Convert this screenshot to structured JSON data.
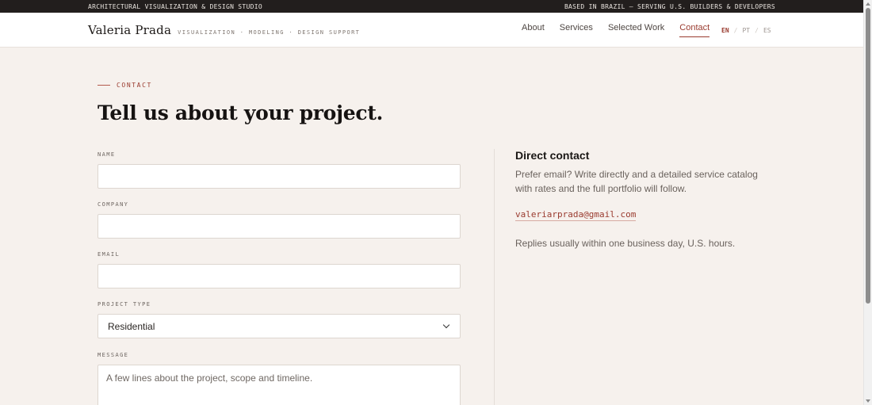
{
  "topbar": {
    "left": "ARCHITECTURAL VISUALIZATION & DESIGN STUDIO",
    "right": "BASED IN BRAZIL — SERVING U.S. BUILDERS & DEVELOPERS"
  },
  "header": {
    "brand": "Valeria Prada",
    "tagline": "VISUALIZATION · MODELING · DESIGN SUPPORT",
    "nav": {
      "about": "About",
      "services": "Services",
      "work": "Selected Work",
      "contact": "Contact"
    },
    "langs": {
      "en": "EN",
      "pt": "PT",
      "es": "ES",
      "sep": "/"
    }
  },
  "contact": {
    "eyebrow": "CONTACT",
    "title": "Tell us about your project.",
    "fields": {
      "name_label": "NAME",
      "company_label": "COMPANY",
      "email_label": "EMAIL",
      "type_label": "PROJECT TYPE",
      "type_value": "Residential",
      "message_label": "MESSAGE",
      "message_placeholder": "A few lines about the project, scope and timeline."
    }
  },
  "direct": {
    "title": "Direct contact",
    "text": "Prefer email? Write directly and a detailed service catalog with rates and the full portfolio will follow.",
    "email": "valeriarprada@gmail.com",
    "note": "Replies usually within one business day, U.S. hours."
  },
  "colors": {
    "accent": "#9a3b2f",
    "background": "#f6f1ed",
    "topbar": "#221e1d"
  }
}
